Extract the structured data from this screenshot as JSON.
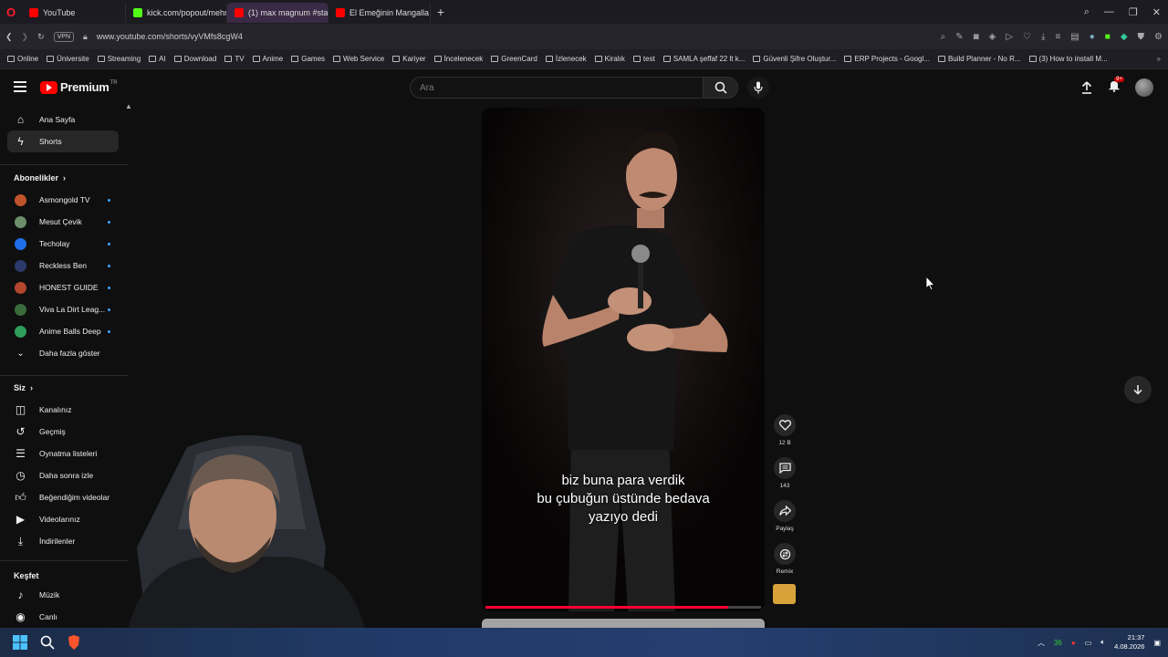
{
  "browser": {
    "tabs": [
      {
        "label": "YouTube",
        "fav_color": "#ff0000",
        "active": false
      },
      {
        "label": "kick.com/popout/mehme",
        "fav_color": "#53fc18",
        "active": false
      },
      {
        "label": "(1) max magnum #sta",
        "fav_color": "#ff0000",
        "active": true
      },
      {
        "label": "El Emeğinin Mangalla Buluş",
        "fav_color": "#ff0000",
        "active": false
      }
    ],
    "url": "www.youtube.com/shorts/vyVMfs8cgW4",
    "vpn_label": "VPN",
    "bookmarks": [
      "Online",
      "Üniversite",
      "Streaming",
      "AI",
      "Download",
      "TV",
      "Anime",
      "Games",
      "Web Service",
      "Kariyer",
      "İncelenecek",
      "GreenCard",
      "İzlenecek",
      "Kiralık",
      "test",
      "SAMLA şeffaf 22 lt k...",
      "Güvenli Şifre Oluştur...",
      "ERP Projects - Googl...",
      "Build Planner - No R...",
      "(3) How to install M..."
    ]
  },
  "header": {
    "logo_text": "Premium",
    "logo_region": "TR",
    "search_placeholder": "Ara",
    "notification_count": "9+"
  },
  "sidebar": {
    "main": [
      {
        "label": "Ana Sayfa",
        "icon": "home-icon"
      },
      {
        "label": "Shorts",
        "icon": "shorts-icon",
        "active": true
      }
    ],
    "subs_title": "Abonelikler",
    "channels": [
      {
        "label": "Asmongold TV",
        "color": "#c0532b"
      },
      {
        "label": "Mesut Çevik",
        "color": "#6b8e6b"
      },
      {
        "label": "Techolay",
        "color": "#1f6feb"
      },
      {
        "label": "Reckless Ben",
        "color": "#2b3a6b"
      },
      {
        "label": "HONEST GUIDE",
        "color": "#b4462e"
      },
      {
        "label": "Viva La Dirt Leag...",
        "color": "#3a6b3a"
      },
      {
        "label": "Anime Balls Deep",
        "color": "#2e9e5a"
      }
    ],
    "show_more": "Daha fazla göster",
    "you_title": "Siz",
    "you_items": [
      {
        "label": "Kanalınız",
        "icon": "account-icon"
      },
      {
        "label": "Geçmiş",
        "icon": "history-icon"
      },
      {
        "label": "Oynatma listeleri",
        "icon": "playlist-icon"
      },
      {
        "label": "Daha sonra izle",
        "icon": "clock-icon"
      },
      {
        "label": "Beğendiğim videolar",
        "icon": "like-icon"
      },
      {
        "label": "Videolarınız",
        "icon": "video-icon"
      },
      {
        "label": "İndirilenler",
        "icon": "download-icon"
      }
    ],
    "explore_title": "Keşfet",
    "explore_items": [
      {
        "label": "Müzik",
        "icon": "music-icon"
      },
      {
        "label": "Canlı",
        "icon": "live-icon"
      }
    ]
  },
  "video": {
    "subtitle_lines": [
      "biz buna para verdik",
      "bu çubuğun üstünde bedava",
      "yazıyo dedi"
    ],
    "progress_fraction": 0.88
  },
  "actions": [
    {
      "name": "like",
      "label": "12 B",
      "icon": "heart-icon"
    },
    {
      "name": "comment",
      "label": "143",
      "icon": "comment-icon"
    },
    {
      "name": "share",
      "label": "Paylaş",
      "icon": "share-icon"
    },
    {
      "name": "remix",
      "label": "Remix",
      "icon": "remix-icon"
    }
  ],
  "taskbar": {
    "time": "21:37",
    "date": "4.08.2026",
    "tray_badge": "36"
  }
}
